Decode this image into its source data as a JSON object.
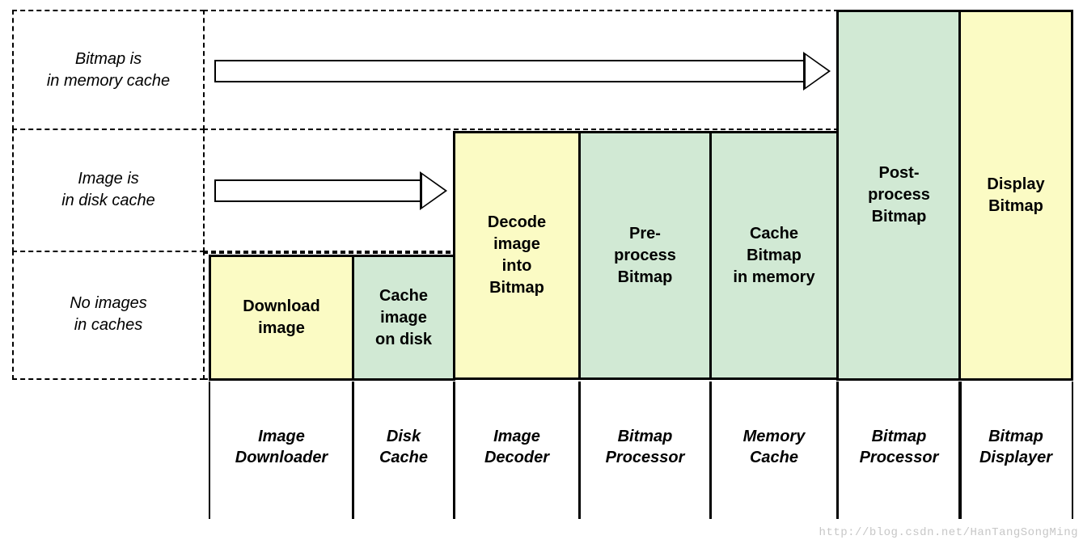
{
  "rows": {
    "r1": "Bitmap is\nin memory cache",
    "r2": "Image is\nin disk cache",
    "r3": "No images\nin caches"
  },
  "boxes": {
    "col1": "Download\nimage",
    "col2": "Cache\nimage\non disk",
    "col3": "Decode\nimage\ninto\nBitmap",
    "col4": "Pre-\nprocess\nBitmap",
    "col5": "Cache\nBitmap\nin memory",
    "col6": "Post-\nprocess\nBitmap",
    "col7": "Display\nBitmap"
  },
  "columns": {
    "cl1": "Image\nDownloader",
    "cl2": "Disk\nCache",
    "cl3": "Image\nDecoder",
    "cl4": "Bitmap\nProcessor",
    "cl5": "Memory\nCache",
    "cl6": "Bitmap\nProcessor",
    "cl7": "Bitmap\nDisplayer"
  },
  "watermark": "http://blog.csdn.net/HanTangSongMing"
}
